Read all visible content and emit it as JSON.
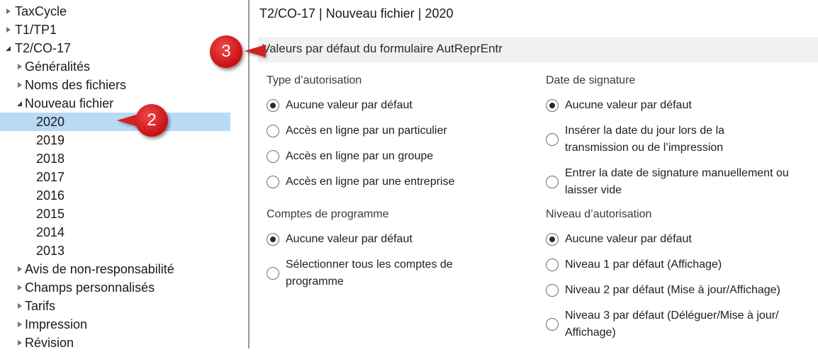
{
  "tree": {
    "items": [
      {
        "label": "TaxCycle",
        "arrow": "right",
        "indent": 0,
        "selected": false
      },
      {
        "label": "T1/TP1",
        "arrow": "right",
        "indent": 0,
        "selected": false
      },
      {
        "label": "T2/CO-17",
        "arrow": "down",
        "indent": 0,
        "selected": false
      },
      {
        "label": "Généralités",
        "arrow": "right",
        "indent": 1,
        "selected": false
      },
      {
        "label": "Noms des fichiers",
        "arrow": "right",
        "indent": 1,
        "selected": false
      },
      {
        "label": "Nouveau fichier",
        "arrow": "down",
        "indent": 1,
        "selected": false
      },
      {
        "label": "2020",
        "arrow": "none",
        "indent": 2,
        "selected": true
      },
      {
        "label": "2019",
        "arrow": "none",
        "indent": 2,
        "selected": false
      },
      {
        "label": "2018",
        "arrow": "none",
        "indent": 2,
        "selected": false
      },
      {
        "label": "2017",
        "arrow": "none",
        "indent": 2,
        "selected": false
      },
      {
        "label": "2016",
        "arrow": "none",
        "indent": 2,
        "selected": false
      },
      {
        "label": "2015",
        "arrow": "none",
        "indent": 2,
        "selected": false
      },
      {
        "label": "2014",
        "arrow": "none",
        "indent": 2,
        "selected": false
      },
      {
        "label": "2013",
        "arrow": "none",
        "indent": 2,
        "selected": false
      },
      {
        "label": "Avis de non-responsabilité",
        "arrow": "right",
        "indent": 1,
        "selected": false
      },
      {
        "label": "Champs personnalisés",
        "arrow": "right",
        "indent": 1,
        "selected": false
      },
      {
        "label": "Tarifs",
        "arrow": "right",
        "indent": 1,
        "selected": false
      },
      {
        "label": "Impression",
        "arrow": "right",
        "indent": 1,
        "selected": false
      },
      {
        "label": "Révision",
        "arrow": "right",
        "indent": 1,
        "selected": false
      }
    ]
  },
  "main": {
    "title": "T2/CO-17 | Nouveau fichier | 2020",
    "section_header": "Valeurs par défaut du formulaire AutReprEntr",
    "groups": {
      "authorization_type": {
        "label": "Type d’autorisation",
        "options": [
          {
            "lines": [
              "Aucune valeur par défaut"
            ],
            "checked": true
          },
          {
            "lines": [
              "Accès en ligne par un particulier"
            ],
            "checked": false
          },
          {
            "lines": [
              "Accès en ligne par un groupe"
            ],
            "checked": false
          },
          {
            "lines": [
              "Accès en ligne par une entreprise"
            ],
            "checked": false
          }
        ]
      },
      "program_accounts": {
        "label": "Comptes de programme",
        "options": [
          {
            "lines": [
              "Aucune valeur par défaut"
            ],
            "checked": true
          },
          {
            "lines": [
              "Sélectionner tous les comptes de",
              "programme"
            ],
            "checked": false
          }
        ]
      },
      "signature_date": {
        "label": "Date de signature",
        "options": [
          {
            "lines": [
              "Aucune valeur par défaut"
            ],
            "checked": true
          },
          {
            "lines": [
              "Insérer la date du jour lors de la",
              "transmission ou de l’impression"
            ],
            "checked": false
          },
          {
            "lines": [
              "Entrer la date de signature manuellement ou",
              "laisser vide"
            ],
            "checked": false
          }
        ]
      },
      "authorization_level": {
        "label": "Niveau d’autorisation",
        "options": [
          {
            "lines": [
              "Aucune valeur par défaut"
            ],
            "checked": true
          },
          {
            "lines": [
              "Niveau 1 par défaut (Affichage)"
            ],
            "checked": false
          },
          {
            "lines": [
              "Niveau 2 par défaut (Mise à jour/Affichage)"
            ],
            "checked": false
          },
          {
            "lines": [
              "Niveau 3 par défaut (Déléguer/Mise à jour/",
              "Affichage)"
            ],
            "checked": false
          }
        ]
      }
    }
  },
  "callouts": [
    {
      "number": "3",
      "target": "section-header"
    },
    {
      "number": "2",
      "target": "tree-item-2020"
    }
  ],
  "colors": {
    "selection": "#b9d9f5",
    "header_bg": "#f1f1f1",
    "callout_red": "#d7191e"
  }
}
